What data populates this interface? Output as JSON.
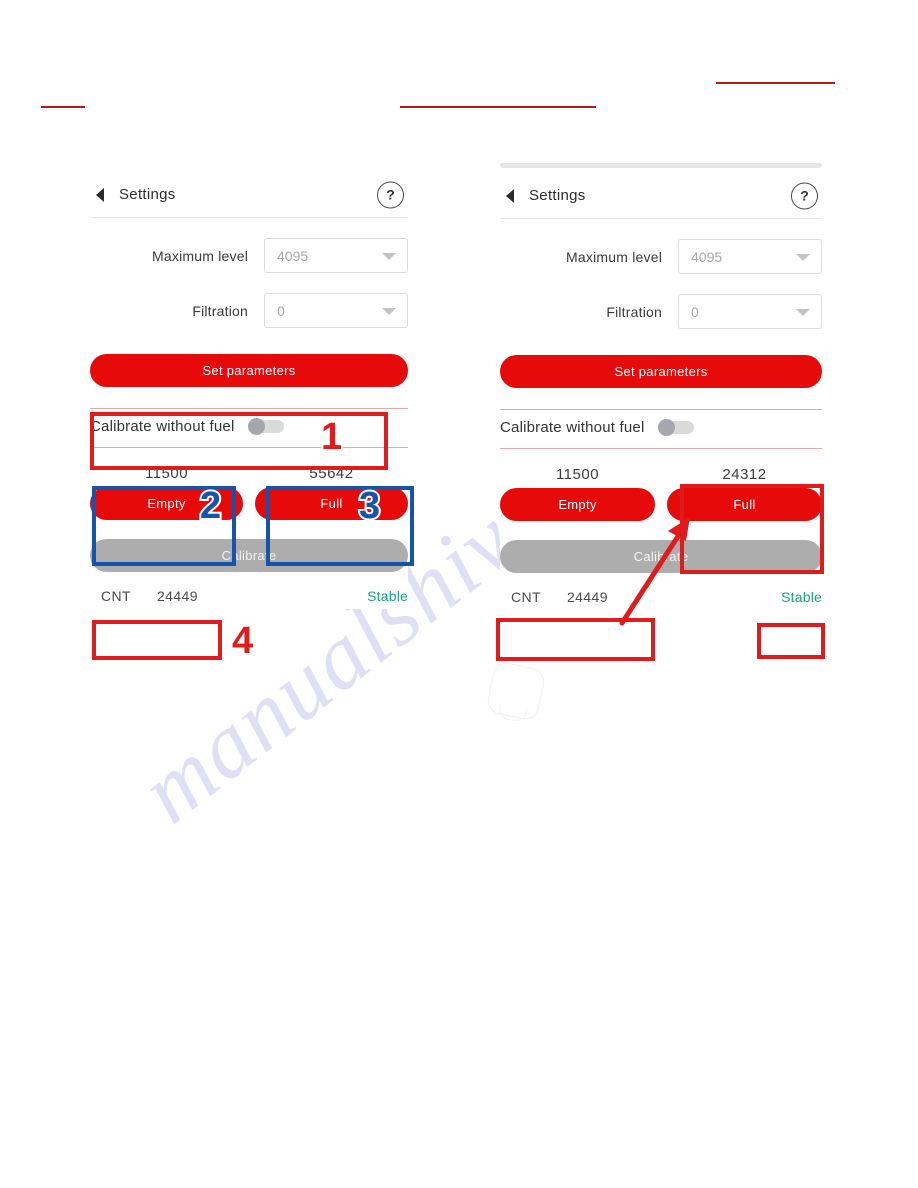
{
  "page": {
    "watermark": "manualshive.com"
  },
  "redactions": [
    {
      "label": "redaction-line-1"
    },
    {
      "label": "redaction-line-2"
    },
    {
      "label": "redaction-line-3"
    }
  ],
  "panel_left": {
    "header": {
      "back_icon": "back-arrow-icon",
      "title": "Settings",
      "help_label": "?"
    },
    "fields": [
      {
        "label": "Maximum level",
        "value": "4095",
        "caret_icon": "chevron-down-icon"
      },
      {
        "label": "Filtration",
        "value": "0",
        "caret_icon": "chevron-down-icon"
      }
    ],
    "set_parameters_label": "Set parameters",
    "toggle": {
      "label": "Calibrate without fuel",
      "state": "off"
    },
    "empty": {
      "value": "11500",
      "button_label": "Empty"
    },
    "full": {
      "value": "55642",
      "button_label": "Full"
    },
    "calibrate_label": "Calibrate",
    "counter": {
      "label": "CNT",
      "value": "24449"
    },
    "status": "Stable"
  },
  "panel_right": {
    "header": {
      "back_icon": "back-arrow-icon",
      "title": "Settings",
      "help_label": "?"
    },
    "fields": [
      {
        "label": "Maximum level",
        "value": "4095",
        "caret_icon": "chevron-down-icon"
      },
      {
        "label": "Filtration",
        "value": "0",
        "caret_icon": "chevron-down-icon"
      }
    ],
    "set_parameters_label": "Set parameters",
    "toggle": {
      "label": "Calibrate without fuel",
      "state": "off"
    },
    "empty": {
      "value": "11500",
      "button_label": "Empty"
    },
    "full": {
      "value": "24312",
      "button_label": "Full"
    },
    "calibrate_label": "Calibrate",
    "counter": {
      "label": "CNT",
      "value": "24449"
    },
    "status": "Stable"
  },
  "annotations": {
    "numbers": [
      {
        "text": "1",
        "color": "#e01b1b",
        "target": "calibrate-without-fuel-toggle"
      },
      {
        "text": "2",
        "color": "#1554a8",
        "target": "empty-cell"
      },
      {
        "text": "3",
        "color": "#1554a8",
        "target": "full-cell"
      },
      {
        "text": "4",
        "color": "#e01b1b",
        "target": "counter-box"
      }
    ],
    "arrow": {
      "color": "#e01b1b",
      "points_to": "full-value-box"
    }
  },
  "colors": {
    "brand_red": "#e60a0a",
    "annotation_red": "#e01b1b",
    "annotation_blue": "#1554a8",
    "status_green": "#17a77a",
    "disabled_gray": "#adadad",
    "watermark": "#ccccf0"
  }
}
